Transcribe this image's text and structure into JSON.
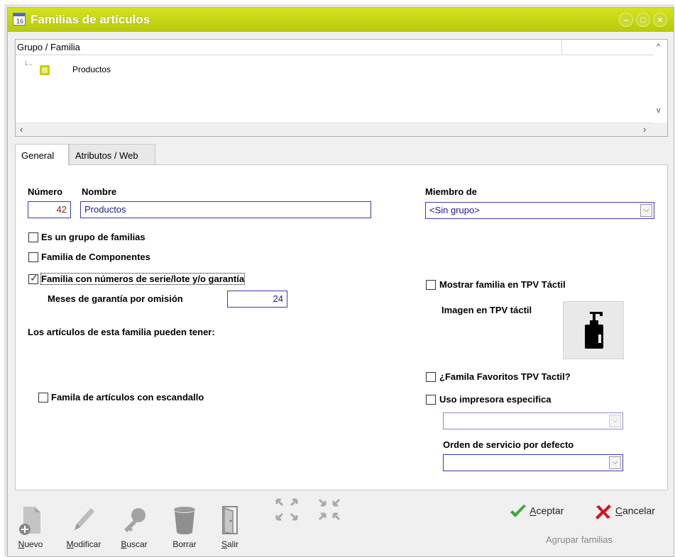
{
  "window": {
    "title": "Familias de artículos"
  },
  "tree": {
    "header": "Grupo / Familia",
    "nodes": [
      {
        "label": "Productos"
      }
    ]
  },
  "tabs": [
    {
      "label": "General",
      "active": true
    },
    {
      "label": "Atributos / Web",
      "active": false
    }
  ],
  "form": {
    "numero_label": "Número",
    "numero_value": "42",
    "nombre_label": "Nombre",
    "nombre_value": "Productos",
    "miembro_label": "Miembro de",
    "miembro_value": "<Sin grupo>",
    "es_grupo_label": "Es un grupo de familias",
    "es_grupo_checked": false,
    "componentes_label": "Familia de Componentes",
    "componentes_checked": false,
    "serie_label": "Familia con números de serie/lote y/o garantía",
    "serie_checked": true,
    "meses_label": "Meses de garantía por omisión",
    "meses_value": "24",
    "articulos_label": "Los artículos de esta familia pueden tener:",
    "escandallo_label": "Famila de artículos con escandallo",
    "escandallo_checked": false,
    "mostrar_tpv_label": "Mostrar familia en TPV Táctil",
    "mostrar_tpv_checked": false,
    "imagen_tpv_label": "Imagen en TPV táctil",
    "favoritos_label": "¿Famila Favoritos TPV Tactil?",
    "favoritos_checked": false,
    "impresora_label": "Uso impresora especifica",
    "impresora_checked": false,
    "impresora_value": "",
    "orden_label": "Orden de servicio por defecto",
    "orden_value": ""
  },
  "toolbar": {
    "nuevo": {
      "key": "N",
      "rest": "uevo"
    },
    "modificar": {
      "key": "M",
      "rest": "odificar"
    },
    "buscar": {
      "key": "B",
      "rest": "uscar"
    },
    "borrar": {
      "key": "",
      "rest": "Borrar"
    },
    "salir": {
      "key": "S",
      "rest": "alir"
    }
  },
  "actions": {
    "aceptar": {
      "key": "A",
      "rest": "ceptar"
    },
    "cancelar": {
      "key": "C",
      "rest": "ancelar"
    },
    "agrupar": "Agrupar familias"
  },
  "colors": {
    "titlebar": "#c3d31a",
    "field_border": "#3b3bb0",
    "accept": "#3aa935",
    "cancel": "#d0141e"
  }
}
